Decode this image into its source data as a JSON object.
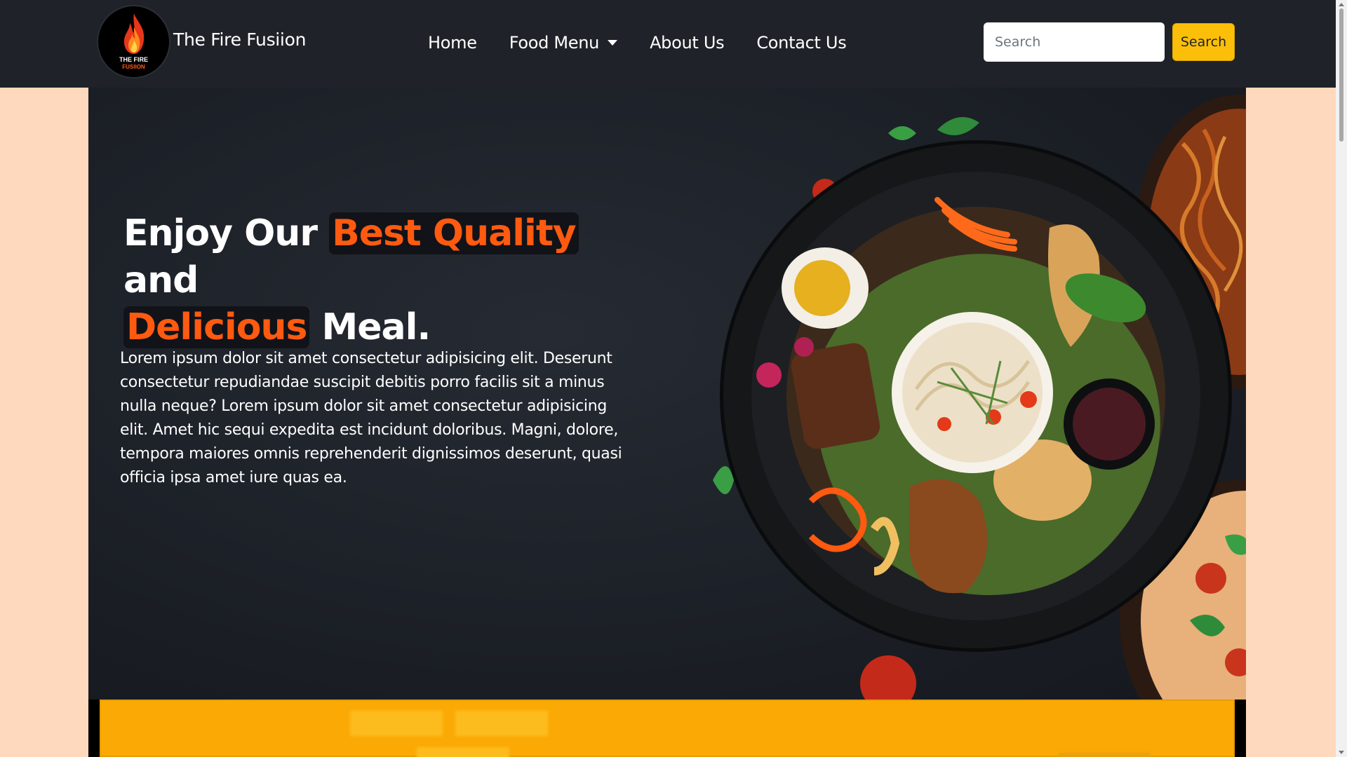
{
  "navbar": {
    "logo_line1": "THE FIRE",
    "logo_line2": "FUSIION",
    "brand": "The Fire Fusiion",
    "links": [
      {
        "label": "Home"
      },
      {
        "label": "Food Menu",
        "dropdown": true
      },
      {
        "label": "About Us"
      },
      {
        "label": "Contact Us"
      }
    ],
    "search_placeholder": "Search",
    "search_button": "Search"
  },
  "hero": {
    "heading_part1": "Enjoy Our ",
    "heading_highlight1": "Best Quality",
    "heading_part2": " and",
    "heading_highlight2": "Delicious",
    "heading_part3": " Meal.",
    "paragraph": "Lorem ipsum dolor sit amet consectetur adipisicing elit. Deserunt consectetur repudiandae suscipit debitis porro facilis sit a minus nulla neque? Lorem ipsum dolor sit amet consectetur adipisicing elit. Amet hic sequi expedita est incidunt doloribus. Magni, dolore, tempora maiores omnis reprehenderit dignissimos deserunt, quasi officia ipsa amet iure quas ea."
  },
  "colors": {
    "navbar_bg": "#1f2329",
    "accent_orange": "#ff5a10",
    "search_button_yellow": "#fbbf0a",
    "page_bg": "#ffd9bd",
    "section_yellow": "#fba905"
  }
}
